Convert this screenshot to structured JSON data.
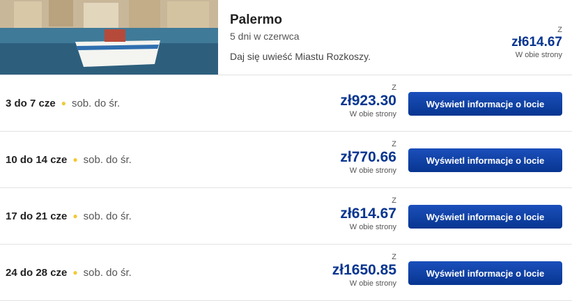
{
  "destination": {
    "name": "Palermo",
    "dates": "5 dni w czerwca",
    "tagline": "Daj się uwieść Miastu Rozkoszy.",
    "price_prefix": "Z",
    "price": "zł614.67",
    "price_suffix": "W obie strony"
  },
  "rows": [
    {
      "range": "3 do 7 cze",
      "days": "sob. do śr.",
      "price_prefix": "Z",
      "price": "zł923.30",
      "price_suffix": "W obie strony",
      "button": "Wyświetl informacje o locie"
    },
    {
      "range": "10 do 14 cze",
      "days": "sob. do śr.",
      "price_prefix": "Z",
      "price": "zł770.66",
      "price_suffix": "W obie strony",
      "button": "Wyświetl informacje o locie"
    },
    {
      "range": "17 do 21 cze",
      "days": "sob. do śr.",
      "price_prefix": "Z",
      "price": "zł614.67",
      "price_suffix": "W obie strony",
      "button": "Wyświetl informacje o locie"
    },
    {
      "range": "24 do 28 cze",
      "days": "sob. do śr.",
      "price_prefix": "Z",
      "price": "zł1650.85",
      "price_suffix": "W obie strony",
      "button": "Wyświetl informacje o locie"
    }
  ],
  "colors": {
    "brand": "#073590",
    "accent_dot": "#f1c933"
  }
}
